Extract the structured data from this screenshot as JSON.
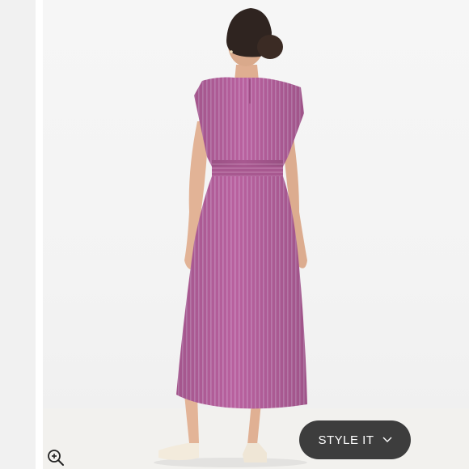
{
  "viewer": {
    "style_button_label": "STYLE IT",
    "icons": {
      "zoom": "zoom-in-icon",
      "dropdown": "chevron-down-icon"
    },
    "colors": {
      "dress": "#b8649f",
      "button": "#3d3d3d"
    }
  }
}
